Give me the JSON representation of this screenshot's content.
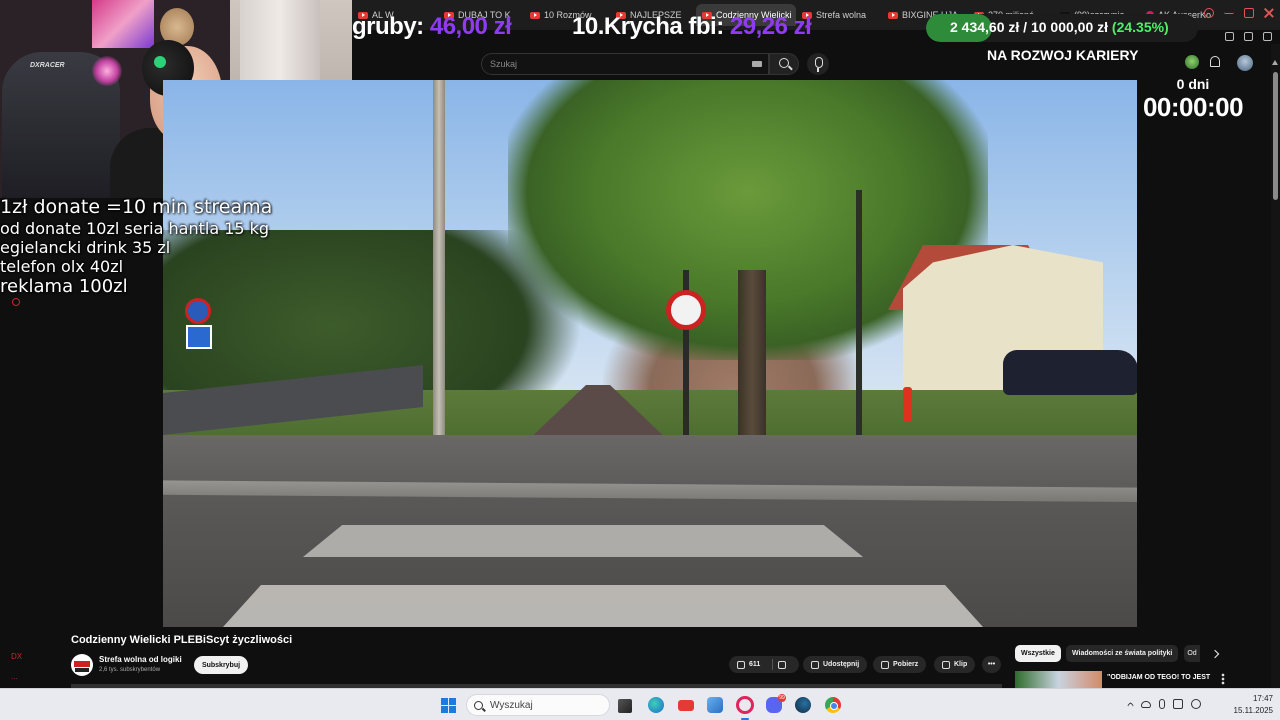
{
  "browser": {
    "tabs": [
      {
        "label": "AL W",
        "icon": "youtube-icon"
      },
      {
        "label": "DUBAJ TO K",
        "icon": "youtube-icon"
      },
      {
        "label": "10 Rozmów",
        "icon": "youtube-icon"
      },
      {
        "label": "NAJLEPSZE",
        "icon": "youtube-icon"
      },
      {
        "label": "Codzienny Wielicki",
        "icon": "youtube-icon",
        "active": true
      },
      {
        "label": "Strefa wolna",
        "icon": "youtube-icon"
      },
      {
        "label": "BIXGINE UJA",
        "icon": "youtube-icon"
      },
      {
        "label": "270 milionó",
        "icon": "youtube-icon"
      },
      {
        "label": "(99)szczypio",
        "icon": "tiktok-icon"
      },
      {
        "label": "AK AusserKo",
        "icon": "pink-icon"
      }
    ]
  },
  "overlay": {
    "lb_left_name": "gruby:",
    "lb_left_amount": "46,00 zł",
    "lb_right_name": "10.Krycha fbi:",
    "lb_right_amount": "29,26 zł",
    "goal_current": "2 434,60 zł",
    "goal_separator": "/",
    "goal_target": "10 000,00 zł",
    "goal_percent": "(24.35%)",
    "goal_fraction": 0.2435,
    "career_label": "NA ROZWOJ KARIERY",
    "timer_days": "0 dni",
    "timer_time": "00:00:00",
    "donate_lines": [
      "1zł donate =10 min streama",
      "od donate 10zl seria hantla 15 kg",
      "egielancki drink 35 zl",
      "telefon olx 40zl",
      "reklama 100zl"
    ],
    "webcam_chair_brand": "DXRACER",
    "side_marks": [
      "DX",
      "..."
    ]
  },
  "youtube": {
    "search_placeholder": "Szukaj",
    "video_title": "Codzienny Wielicki PLEBiScyt życzliwości",
    "channel_name": "Strefa wolna od logiki",
    "channel_subs": "2,6 tys. subskrybentów",
    "subscribe_label": "Subskrybuj",
    "like_count": "611",
    "share_label": "Udostępnij",
    "download_label": "Pobierz",
    "clip_label": "Klip",
    "chips": [
      "Wszystkie",
      "Wiadomości ze świata polityki",
      "Od"
    ],
    "rec_title": "\"ODBIJAM OD TEGO! TO JEST OBRZYDLIWE! MALIGNA"
  },
  "taskbar": {
    "search_label": "Wyszukaj",
    "discord_badge": "99",
    "time": "17:47",
    "date": "15.11.2025"
  },
  "colors": {
    "accent_purple": "#8f3cf0",
    "progress_green": "#2e8b3a",
    "percent_green": "#4ef06a",
    "yt_red": "#e53935"
  }
}
